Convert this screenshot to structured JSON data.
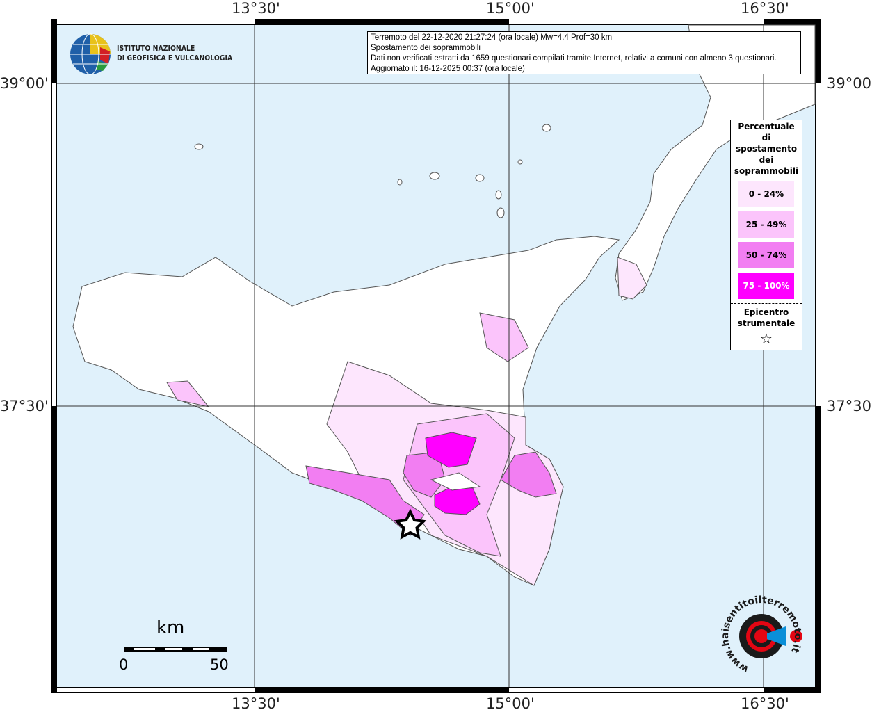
{
  "info": {
    "line1": "Terremoto del 22-12-2020 21:27:24 (ora locale) Mw=4.4 Prof=30 km",
    "line2": "Spostamento dei soprammobili",
    "line3": "Dati non verificati estratti da 1659 questionari compilati tramite Internet, relativi a comuni con almeno 3 questionari.",
    "line4": "Aggiornato il: 16-12-2025 00:37 (ora locale)"
  },
  "logo": {
    "line1": "ISTITUTO NAZIONALE",
    "line2": "DI GEOFISICA E VULCANOLOGIA"
  },
  "axes": {
    "lon": [
      "13°30'",
      "15°00'",
      "16°30'"
    ],
    "lat": [
      "39°00'",
      "37°30'"
    ]
  },
  "legend": {
    "title": [
      "Percentuale",
      "di",
      "spostamento",
      "dei",
      "soprammobili"
    ],
    "classes": [
      {
        "label": "0 - 24%",
        "color": "#fde6fd"
      },
      {
        "label": "25 - 49%",
        "color": "#fbc4fb"
      },
      {
        "label": "50 - 74%",
        "color": "#f27ef2"
      },
      {
        "label": "75 - 100%",
        "color": "#ff00ff"
      }
    ],
    "epicenter_title": [
      "Epicentro",
      "strumentale"
    ],
    "epicenter_symbol": "☆"
  },
  "scale": {
    "unit": "km",
    "min": "0",
    "max": "50"
  },
  "watermark": "www.haisentitoilterremoto.it"
}
